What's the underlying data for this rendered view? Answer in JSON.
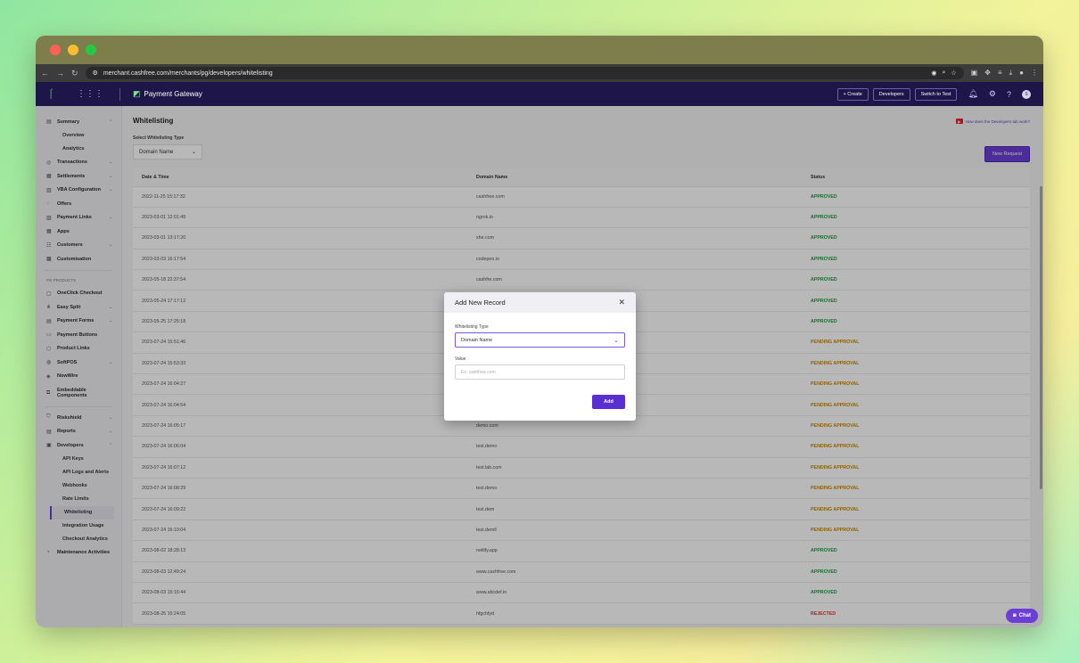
{
  "browser": {
    "url": "merchant.cashfree.com/merchants/pg/developers/whitelisting"
  },
  "header": {
    "product": "Payment Gateway",
    "create_label": "+ Create",
    "developers_label": "Developers",
    "switch_label": "Switch to Test",
    "avatar_initial": "S"
  },
  "sidebar": {
    "summary": "Summary",
    "overview": "Overview",
    "analytics": "Analytics",
    "transactions": "Transactions",
    "settlements": "Settlements",
    "vba": "VBA Configuration",
    "offers": "Offers",
    "payment_links": "Payment Links",
    "apps": "Apps",
    "customers": "Customers",
    "customisation": "Customisation",
    "pg_products": "PG PRODUCTS",
    "oneclick": "OneClick Checkout",
    "easy_split": "Easy Split",
    "payment_forms": "Payment Forms",
    "payment_buttons": "Payment Buttons",
    "product_links": "Product Links",
    "softpos": "SoftPOS",
    "nowwire": "NowWire",
    "embeddable_1": "Embeddable",
    "embeddable_2": "Components",
    "riskshield": "Riskshield",
    "reports": "Reports",
    "developers": "Developers",
    "api_keys": "API Keys",
    "api_logs": "API Logs and Alerts",
    "webhooks": "Webhooks",
    "rate_limits": "Rate Limits",
    "whitelisting": "Whitelisting",
    "integration_usage": "Integration Usage",
    "checkout_analytics": "Checkout Analytics",
    "maintenance": "Maintenance Activities"
  },
  "main": {
    "title": "Whitelisting",
    "help_link": "How does the Developers tab work?",
    "filter_label": "Select Whitelisting Type",
    "filter_value": "Domain Name",
    "new_request": "New Request",
    "columns": [
      "Date & Time",
      "Domain Name",
      "Status"
    ],
    "rows": [
      [
        "2022-11-25 15:17:32",
        "cashfree.com",
        "APPROVED"
      ],
      [
        "2023-03-01 12:01:49",
        "ngrok.io",
        "APPROVED"
      ],
      [
        "2023-03-01 13:17:20",
        "xhe.com",
        "APPROVED"
      ],
      [
        "2023-03-03 16:17:54",
        "codepen.io",
        "APPROVED"
      ],
      [
        "2023-05-18 22:37:54",
        "cashfre.com",
        "APPROVED"
      ],
      [
        "2023-05-24 17:17:12",
        "",
        "APPROVED"
      ],
      [
        "2023-05-25 17:25:18",
        "",
        "APPROVED"
      ],
      [
        "2023-07-24 15:51:46",
        "",
        "PENDING APPROVAL"
      ],
      [
        "2023-07-24 15:53:33",
        "",
        "PENDING APPROVAL"
      ],
      [
        "2023-07-24 16:04:27",
        "",
        "PENDING APPROVAL"
      ],
      [
        "2023-07-24 16:04:54",
        "",
        "PENDING APPROVAL"
      ],
      [
        "2023-07-24 16:05:17",
        "demo.com",
        "PENDING APPROVAL"
      ],
      [
        "2023-07-24 16:06:04",
        "test.demo",
        "PENDING APPROVAL"
      ],
      [
        "2023-07-24 16:07:12",
        "test.lab.com",
        "PENDING APPROVAL"
      ],
      [
        "2023-07-24 16:08:29",
        "test.demo",
        "PENDING APPROVAL"
      ],
      [
        "2023-07-24 16:09:22",
        "test.dem",
        "PENDING APPROVAL"
      ],
      [
        "2023-07-24 16:10:04",
        "test.demll",
        "PENDING APPROVAL"
      ],
      [
        "2023-08-02 18:28:13",
        "netlify.app",
        "APPROVED"
      ],
      [
        "2023-08-03 12:49:24",
        "www.cashfree.com",
        "APPROVED"
      ],
      [
        "2023-08-03 15:16:44",
        "www.abcdef.in",
        "APPROVED"
      ],
      [
        "2023-08-25 15:24:05",
        "hfgchfyd",
        "REJECTED"
      ]
    ]
  },
  "modal": {
    "title": "Add New Record",
    "type_label": "Whitelisting Type",
    "type_value": "Domain Name",
    "value_label": "Value",
    "value_placeholder": "Ex: cashfree.com",
    "add_label": "Add"
  },
  "chat_label": "Chat"
}
